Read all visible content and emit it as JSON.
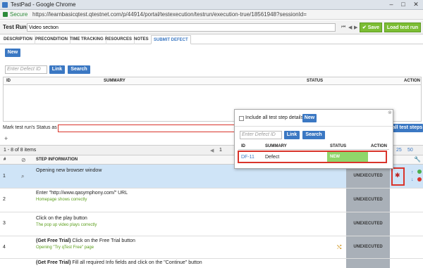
{
  "window": {
    "title": "TestPad - Google Chrome",
    "min": "–",
    "max": "□",
    "close": "✕"
  },
  "address": {
    "secure": "Secure",
    "url": "https://learnbasicqtest.qtestnet.com/p/44914/portal/testexecution/testrun/execution-true/18561948?sessionId="
  },
  "run": {
    "label": "Test Run",
    "name": "Video section",
    "save": "Save",
    "load": "Load test run"
  },
  "tabs": [
    "DESCRIPTION",
    "PRECONDITION",
    "TIME TRACKING",
    "RESOURCES",
    "NOTES",
    "SUBMIT DEFECT"
  ],
  "defects": {
    "new": "New",
    "placeholder": "Enter Defect ID",
    "link": "Link",
    "search": "Search",
    "cols": {
      "id": "ID",
      "summary": "SUMMARY",
      "status": "STATUS",
      "action": "ACTION"
    }
  },
  "status_row": {
    "label": "Mark test run's Status as",
    "all_steps": "all test steps"
  },
  "plus": "+",
  "pager": {
    "items": "1 - 8 of 8 items",
    "page": "1",
    "size_a": "25",
    "size_b": "50"
  },
  "steps": {
    "cols": {
      "num": "#",
      "info": "STEP INFORMATION"
    },
    "rows": [
      {
        "num": "1",
        "text": "Opening new browser window",
        "result": "",
        "status": "UNEXECUTED"
      },
      {
        "num": "2",
        "text": "Enter \"http://www.qasymphony.com/\" URL",
        "result": "Homepage shows correctly",
        "status": "UNEXECUTED"
      },
      {
        "num": "3",
        "text": "Click on the play button",
        "result": "The pop up video plays correctly",
        "status": "UNEXECUTED"
      },
      {
        "num": "4",
        "text_bold": "(Get Free Trial)",
        "text": " Click on the Free Trial button",
        "result": "Opening \"Try qTest Free\" page",
        "status": "UNEXECUTED"
      },
      {
        "num": "",
        "text_bold": "(Get Free Trial)",
        "text": " Fill all required Info fields and click on the \"Continue\" button",
        "result": "",
        "status": ""
      }
    ]
  },
  "popup": {
    "checkbox_label": "Include all test step details",
    "new": "New",
    "placeholder": "Enter Defect ID",
    "link": "Link",
    "search": "Search",
    "cols": {
      "id": "ID",
      "summary": "SUMMARY",
      "status": "STATUS",
      "action": "ACTION"
    },
    "row": {
      "id": "DF-11",
      "summary": "Defect",
      "status": "NEW"
    },
    "close": "⊗"
  },
  "colors": {
    "accent": "#3b78c3",
    "green": "#7cbd34",
    "highlight": "#d9342b"
  }
}
